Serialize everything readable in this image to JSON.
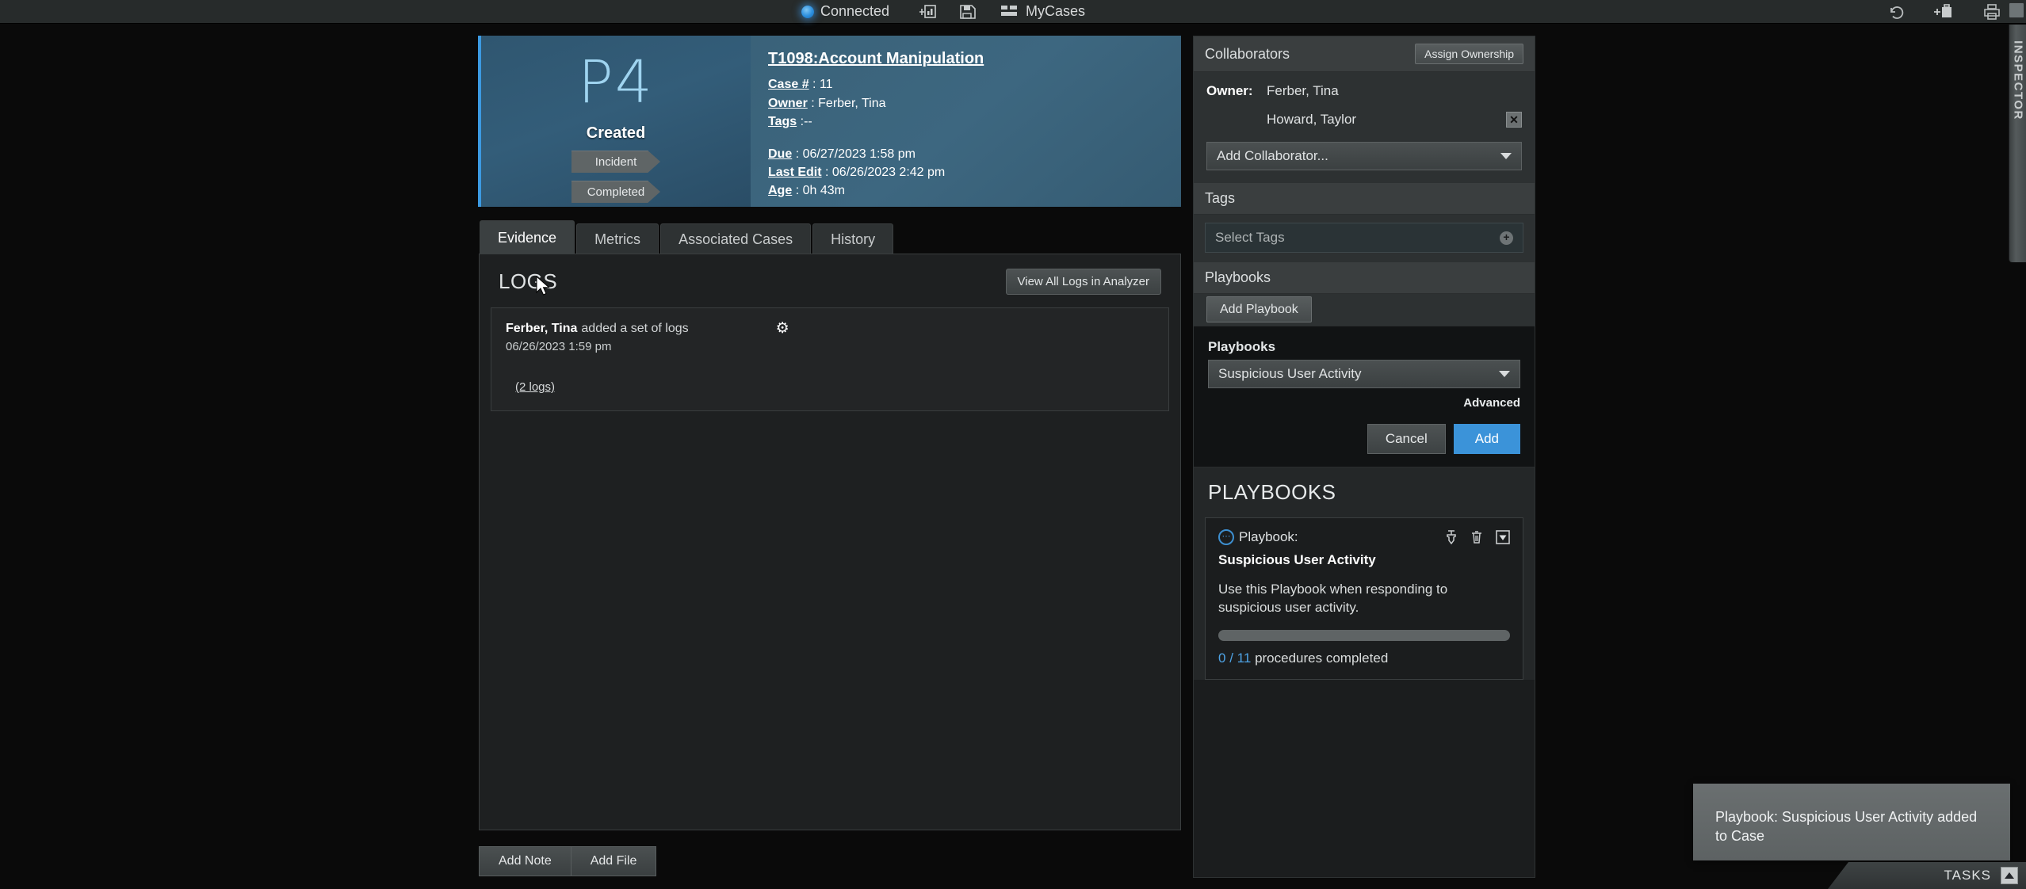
{
  "topbar": {
    "connection_status": "Connected",
    "connection_icon": "status-dot-icon",
    "add_case_icon": "add-chart-icon",
    "save_icon": "save-disk-icon",
    "mycases_icon": "grid-icon",
    "mycases_label": "MyCases",
    "undo_icon": "undo-icon",
    "add_briefcase_icon": "add-briefcase-icon",
    "print_icon": "printer-icon"
  },
  "inspector": {
    "label": "INSPECTOR",
    "toggle_icon": "inspector-toggle-icon"
  },
  "case": {
    "priority": "P4",
    "state": "Created",
    "badges": [
      "Incident",
      "Completed"
    ],
    "title": "T1098:Account Manipulation",
    "fields": [
      {
        "label": "Case #",
        "value": "11"
      },
      {
        "label": "Owner",
        "value": "Ferber, Tina"
      },
      {
        "label": "Tags",
        "value": "--"
      }
    ],
    "fields2": [
      {
        "label": "Due",
        "value": "06/27/2023 1:58 pm"
      },
      {
        "label": "Last Edit",
        "value": "06/26/2023 2:42 pm"
      },
      {
        "label": "Age",
        "value": "0h 43m"
      }
    ]
  },
  "tabs": [
    {
      "label": "Evidence",
      "active": true
    },
    {
      "label": "Metrics",
      "active": false
    },
    {
      "label": "Associated Cases",
      "active": false
    },
    {
      "label": "History",
      "active": false
    }
  ],
  "logs": {
    "title": "LOGS",
    "view_all_button": "View All Logs in Analyzer",
    "gear_icon": "gear-icon",
    "entries": [
      {
        "actor": "Ferber, Tina",
        "action": "added a set of logs",
        "timestamp": "06/26/2023 1:59 pm",
        "count_link": "(2 logs)"
      }
    ]
  },
  "bottom_actions": {
    "add_note": "Add Note",
    "add_file": "Add File"
  },
  "sidebar": {
    "collaborators": {
      "heading": "Collaborators",
      "assign_button": "Assign Ownership",
      "owner_label": "Owner:",
      "owner_name": "Ferber, Tina",
      "collaborator_name": "Howard, Taylor",
      "remove_icon": "close-x-icon",
      "add_placeholder": "Add Collaborator...",
      "dropdown_icon": "chevron-down-icon"
    },
    "tags": {
      "heading": "Tags",
      "placeholder": "Select Tags",
      "add_icon": "plus-circle-icon"
    },
    "playbooks_panel": {
      "heading": "Playbooks",
      "add_button": "Add Playbook"
    },
    "playbook_form": {
      "label": "Playbooks",
      "selected": "Suspicious User Activity",
      "dropdown_icon": "chevron-down-icon",
      "advanced_link": "Advanced",
      "cancel_button": "Cancel",
      "add_button": "Add"
    },
    "playbooks_list": {
      "heading": "PLAYBOOKS",
      "cards": [
        {
          "collapse_icon": "collapse-circle-icon",
          "kicker": "Playbook:",
          "name": "Suspicious User Activity",
          "description": "Use this Playbook when responding to suspicious user activity.",
          "pin_icon": "pin-icon",
          "delete_icon": "trash-icon",
          "expand_icon": "chevron-down-box-icon",
          "progress_percent": 0,
          "completed": "0",
          "separator": "/",
          "total": "11",
          "progress_label": "procedures completed"
        }
      ]
    }
  },
  "toast": {
    "message": "Playbook: Suspicious User Activity added to Case"
  },
  "tasks": {
    "label": "TASKS",
    "caret_icon": "chevron-up-icon"
  },
  "colors": {
    "accent_blue": "#3b93d9",
    "header_blue": "#3d6780",
    "panel_dark": "#1e2021"
  }
}
